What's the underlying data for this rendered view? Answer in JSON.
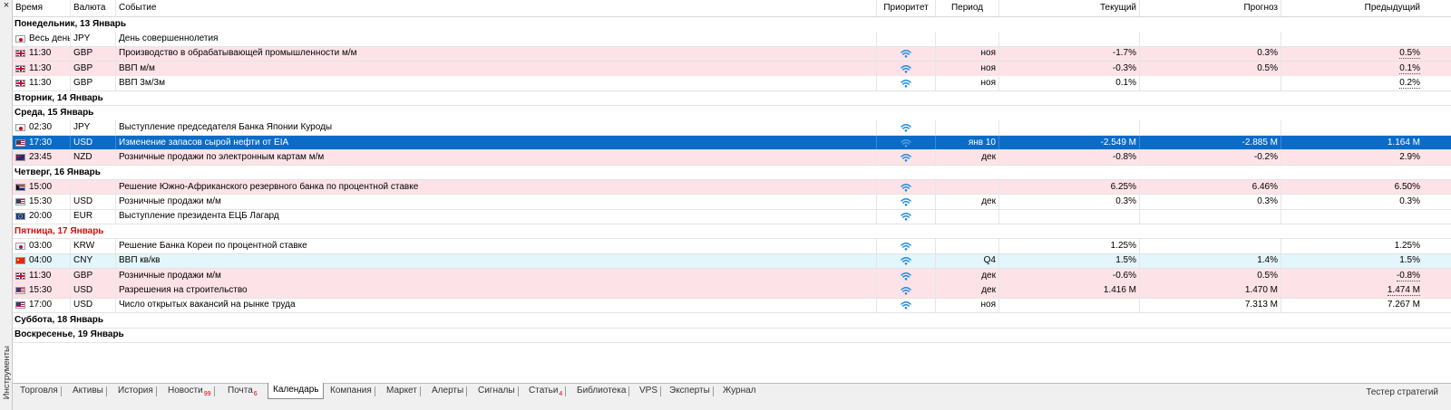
{
  "window": {
    "side_title": "Инструменты",
    "close_glyph": "×"
  },
  "columns": {
    "time": "Время",
    "currency": "Валюта",
    "event": "Событие",
    "priority": "Приоритет",
    "period": "Период",
    "actual": "Текущий",
    "forecast": "Прогноз",
    "previous": "Предыдущий"
  },
  "rows": [
    {
      "type": "day",
      "label": "Понедельник, 13 Январь"
    },
    {
      "type": "event",
      "bg": "white",
      "flag": "jp",
      "time": "Весь день",
      "currency": "JPY",
      "event": "День совершеннолетия",
      "priority": "none",
      "period": "",
      "actual": "",
      "forecast": "",
      "previous": "",
      "prev_dotted": false
    },
    {
      "type": "event",
      "bg": "pink",
      "flag": "gb",
      "time": "11:30",
      "currency": "GBP",
      "event": "Производство в обрабатывающей промышленности м/м",
      "priority": "high",
      "period": "ноя",
      "actual": "-1.7%",
      "forecast": "0.3%",
      "previous": "0.5%",
      "prev_dotted": true
    },
    {
      "type": "event",
      "bg": "pink",
      "flag": "gb",
      "time": "11:30",
      "currency": "GBP",
      "event": "ВВП м/м",
      "priority": "high",
      "period": "ноя",
      "actual": "-0.3%",
      "forecast": "0.5%",
      "previous": "0.1%",
      "prev_dotted": true
    },
    {
      "type": "event",
      "bg": "white",
      "flag": "gb",
      "time": "11:30",
      "currency": "GBP",
      "event": "ВВП 3м/3м",
      "priority": "high",
      "period": "ноя",
      "actual": "0.1%",
      "forecast": "",
      "previous": "0.2%",
      "prev_dotted": true
    },
    {
      "type": "day",
      "label": "Вторник, 14 Январь"
    },
    {
      "type": "day",
      "label": "Среда, 15 Январь"
    },
    {
      "type": "event",
      "bg": "white",
      "flag": "jp",
      "time": "02:30",
      "currency": "JPY",
      "event": "Выступление председателя Банка Японии Куроды",
      "priority": "high",
      "period": "",
      "actual": "",
      "forecast": "",
      "previous": "",
      "prev_dotted": false
    },
    {
      "type": "event",
      "bg": "selected",
      "flag": "us",
      "time": "17:30",
      "currency": "USD",
      "event": "Изменение запасов сырой нефти от EIA",
      "priority": "high",
      "period": "янв 10",
      "actual": "-2.549 M",
      "forecast": "-2.885 M",
      "previous": "1.164 M",
      "prev_dotted": false
    },
    {
      "type": "event",
      "bg": "pink",
      "flag": "nz",
      "time": "23:45",
      "currency": "NZD",
      "event": "Розничные продажи по электронным картам м/м",
      "priority": "high",
      "period": "дек",
      "actual": "-0.8%",
      "forecast": "-0.2%",
      "previous": "2.9%",
      "prev_dotted": false
    },
    {
      "type": "day",
      "label": "Четверг, 16 Январь"
    },
    {
      "type": "event",
      "bg": "pink",
      "flag": "za",
      "time": "15:00",
      "currency": "",
      "event": "Решение Южно-Африканского резервного банка по процентной ставке",
      "priority": "high",
      "period": "",
      "actual": "6.25%",
      "forecast": "6.46%",
      "previous": "6.50%",
      "prev_dotted": false
    },
    {
      "type": "event",
      "bg": "white",
      "flag": "us",
      "time": "15:30",
      "currency": "USD",
      "event": "Розничные продажи м/м",
      "priority": "high",
      "period": "дек",
      "actual": "0.3%",
      "forecast": "0.3%",
      "previous": "0.3%",
      "prev_dotted": false
    },
    {
      "type": "event",
      "bg": "white",
      "flag": "eu",
      "time": "20:00",
      "currency": "EUR",
      "event": "Выступление президента ЕЦБ Лагард",
      "priority": "high",
      "period": "",
      "actual": "",
      "forecast": "",
      "previous": "",
      "prev_dotted": false
    },
    {
      "type": "day",
      "label": "Пятница, 17 Январь",
      "highlight": true
    },
    {
      "type": "event",
      "bg": "white",
      "flag": "kr",
      "time": "03:00",
      "currency": "KRW",
      "event": "Решение Банка Кореи по процентной ставке",
      "priority": "high",
      "period": "",
      "actual": "1.25%",
      "forecast": "",
      "previous": "1.25%",
      "prev_dotted": false
    },
    {
      "type": "event",
      "bg": "cyan",
      "flag": "cn",
      "time": "04:00",
      "currency": "CNY",
      "event": "ВВП кв/кв",
      "priority": "high",
      "period": "Q4",
      "actual": "1.5%",
      "forecast": "1.4%",
      "previous": "1.5%",
      "prev_dotted": false
    },
    {
      "type": "event",
      "bg": "pink",
      "flag": "gb",
      "time": "11:30",
      "currency": "GBP",
      "event": "Розничные продажи м/м",
      "priority": "high",
      "period": "дек",
      "actual": "-0.6%",
      "forecast": "0.5%",
      "previous": "-0.8%",
      "prev_dotted": true
    },
    {
      "type": "event",
      "bg": "pink",
      "flag": "us",
      "time": "15:30",
      "currency": "USD",
      "event": "Разрешения на строительство",
      "priority": "high",
      "period": "дек",
      "actual": "1.416 M",
      "forecast": "1.470 M",
      "previous": "1.474 M",
      "prev_dotted": true
    },
    {
      "type": "event",
      "bg": "white",
      "flag": "us",
      "time": "17:00",
      "currency": "USD",
      "event": "Число открытых вакансий на рынке труда",
      "priority": "high",
      "period": "ноя",
      "actual": "",
      "forecast": "7.313 M",
      "previous": "7.267 M",
      "prev_dotted": false
    },
    {
      "type": "day",
      "label": "Суббота, 18 Январь"
    },
    {
      "type": "day",
      "label": "Воскресенье, 19 Январь"
    }
  ],
  "tabs": [
    {
      "label": "Торговля",
      "badge": ""
    },
    {
      "label": "Активы",
      "badge": ""
    },
    {
      "label": "История",
      "badge": ""
    },
    {
      "label": "Новости",
      "badge": "99"
    },
    {
      "label": "Почта",
      "badge": "6"
    },
    {
      "label": "Календарь",
      "badge": "",
      "active": true
    },
    {
      "label": "Компания",
      "badge": ""
    },
    {
      "label": "Маркет",
      "badge": ""
    },
    {
      "label": "Алерты",
      "badge": ""
    },
    {
      "label": "Сигналы",
      "badge": ""
    },
    {
      "label": "Статьи",
      "badge": "4"
    },
    {
      "label": "Библиотека",
      "badge": ""
    },
    {
      "label": "VPS",
      "badge": ""
    },
    {
      "label": "Эксперты",
      "badge": ""
    },
    {
      "label": "Журнал",
      "badge": ""
    }
  ],
  "strategy_tester": "Тестер стратегий",
  "colors": {
    "selected": "#0a6cc8",
    "pink": "#fde3e8",
    "cyan": "#e2f6fb",
    "importance_icon": "#1a8be0",
    "friday": "#d01010",
    "badge": "#dd0000"
  }
}
